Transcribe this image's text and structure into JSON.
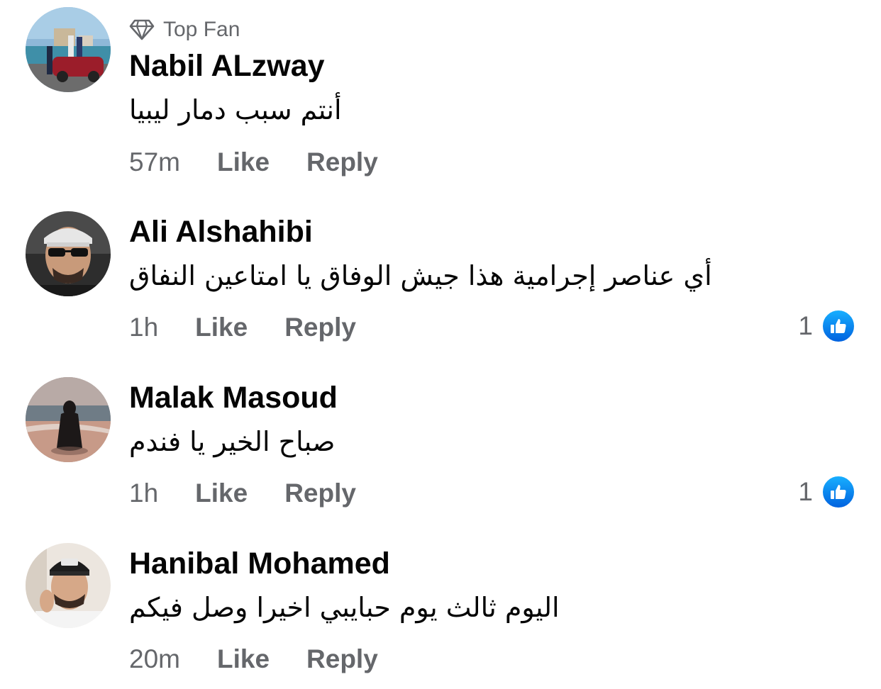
{
  "comments": [
    {
      "badge": "Top Fan",
      "author": "Nabil ALzway",
      "text": "أنتم سبب دمار ليبيا",
      "time": "57m",
      "like_label": "Like",
      "reply_label": "Reply",
      "reaction_count": ""
    },
    {
      "author": "Ali Alshahibi",
      "text": "أي عناصر إجرامية هذا جيش الوفاق يا امتاعين النفاق",
      "time": "1h",
      "like_label": "Like",
      "reply_label": "Reply",
      "reaction_count": "1"
    },
    {
      "author": "Malak Masoud",
      "text": "صباح الخير يا فندم",
      "time": "1h",
      "like_label": "Like",
      "reply_label": "Reply",
      "reaction_count": "1"
    },
    {
      "author": "Hanibal Mohamed",
      "text": "اليوم ثالث يوم حبايبي اخيرا وصل فيكم",
      "time": "20m",
      "like_label": "Like",
      "reply_label": "Reply",
      "reaction_count": ""
    }
  ],
  "colors": {
    "secondary_text": "#65676b",
    "primary_text": "#050505",
    "like_blue": "#1877f2"
  }
}
